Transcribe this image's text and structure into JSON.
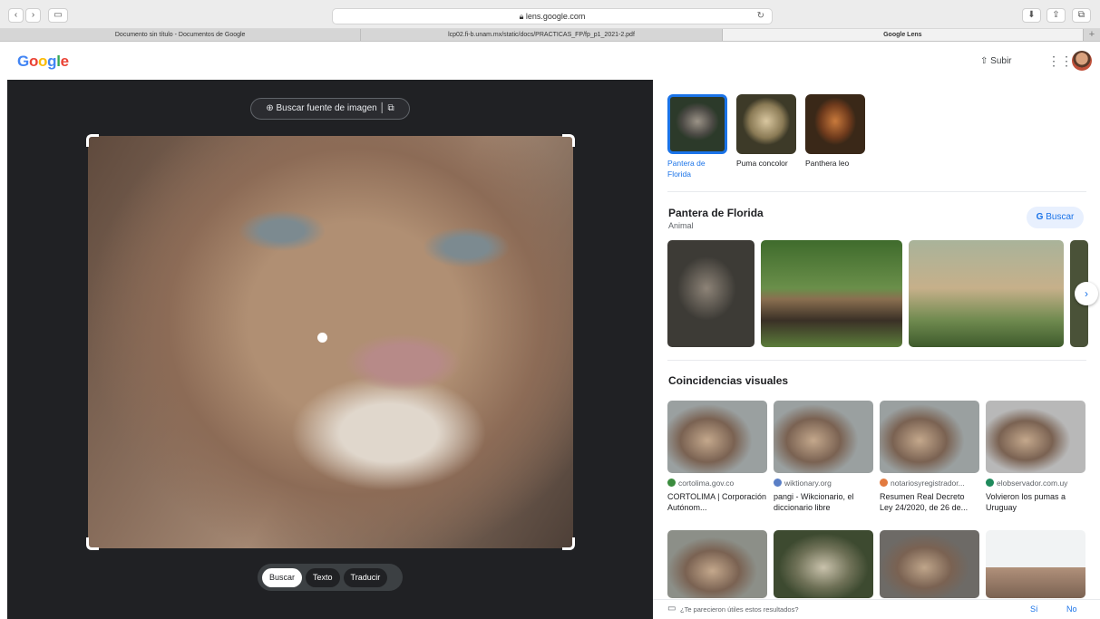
{
  "browser": {
    "url": "lens.google.com",
    "tabs": [
      {
        "label": "Documento sin título - Documentos de Google",
        "active": false
      },
      {
        "label": "lcp02.fi-b.unam.mx/static/docs/PRACTICAS_FP/fp_p1_2021-2.pdf",
        "active": false
      },
      {
        "label": "Google Lens",
        "active": true
      }
    ],
    "new_tab": "+"
  },
  "header": {
    "logo_letters": [
      {
        "ch": "G",
        "color": "#4285f4"
      },
      {
        "ch": "o",
        "color": "#ea4335"
      },
      {
        "ch": "o",
        "color": "#fbbc05"
      },
      {
        "ch": "g",
        "color": "#4285f4"
      },
      {
        "ch": "l",
        "color": "#34a853"
      },
      {
        "ch": "e",
        "color": "#ea4335"
      }
    ],
    "upload_label": "Subir"
  },
  "lens": {
    "source_button": "Buscar fuente de imagen",
    "modes": [
      "Buscar",
      "Texto",
      "Traducir"
    ],
    "active_mode": "Buscar"
  },
  "results": {
    "thumbnails": [
      {
        "label": "Pantera de Florida",
        "selected": true
      },
      {
        "label": "Puma concolor",
        "selected": false
      },
      {
        "label": "Panthera leo",
        "selected": false
      }
    ],
    "entity": {
      "title": "Pantera de Florida",
      "subtitle": "Animal",
      "search_button": "Buscar",
      "search_button_logo": "G"
    },
    "visual_matches_title": "Coincidencias visuales",
    "matches": [
      {
        "site": "cortolima.gov.co",
        "title": "CORTOLIMA | Corporación Autónom...",
        "favicon_color": "#3b8c3e"
      },
      {
        "site": "wiktionary.org",
        "title": "pangi - Wikcionario, el diccionario libre",
        "favicon_color": "#5a7fc6"
      },
      {
        "site": "notariosyregistrador...",
        "title": "Resumen Real Decreto Ley 24/2020, de 26 de...",
        "favicon_color": "#e27a3f"
      },
      {
        "site": "elobservador.com.uy",
        "title": "Volvieron los pumas a Uruguay",
        "favicon_color": "#1f8a5c"
      }
    ],
    "feedback": {
      "question": "¿Te parecieron útiles estos resultados?",
      "yes": "Sí",
      "no": "No"
    }
  }
}
